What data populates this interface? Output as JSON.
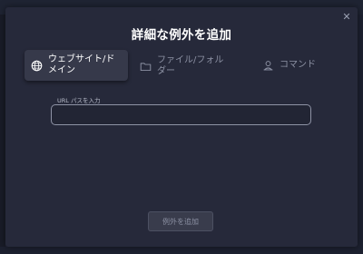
{
  "dialog": {
    "title": "詳細な例外を追加",
    "close_icon": "close-icon"
  },
  "tabs": [
    {
      "label": "ウェブサイト/ドメイン",
      "icon": "globe-icon",
      "active": true
    },
    {
      "label": "ファイル/フォルダー",
      "icon": "folder-icon",
      "active": false
    },
    {
      "label": "コマンド",
      "icon": "command-icon",
      "active": false
    }
  ],
  "url_field": {
    "label": "URL パスを入力",
    "value": "",
    "placeholder": ""
  },
  "add_button": {
    "label": "例外を追加",
    "enabled": false
  },
  "colors": {
    "modal_bg": "#26293a",
    "active_tab_bg": "#36394a",
    "input_border": "#8e93a5",
    "muted_text": "#8c91a3"
  }
}
